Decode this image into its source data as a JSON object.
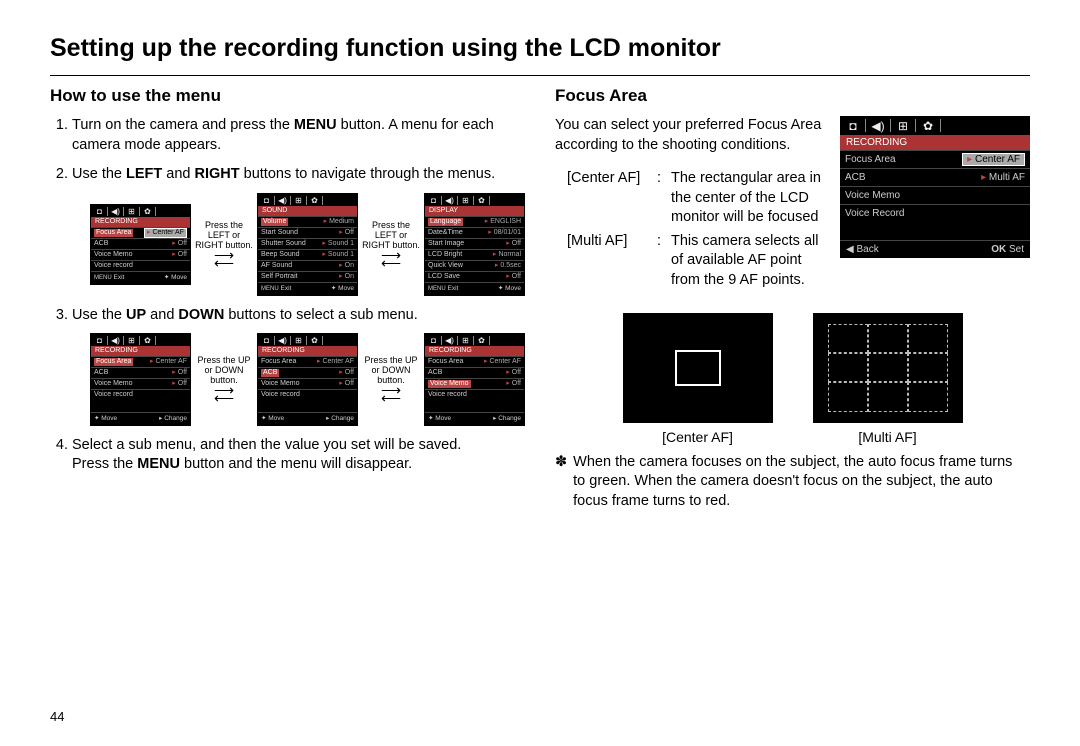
{
  "title": "Setting up the recording function using the LCD monitor",
  "page_number": "44",
  "left": {
    "heading": "How to use the menu",
    "step1_pre": "Turn on the camera and press the ",
    "step1_strong": "MENU",
    "step1_post": " button. A menu for each camera mode appears.",
    "step2_pre": "Use the ",
    "step2_s1": "LEFT",
    "step2_mid": " and ",
    "step2_s2": "RIGHT",
    "step2_post": " buttons to navigate through the menus.",
    "step3_pre": "Use the ",
    "step3_s1": "UP",
    "step3_mid": " and ",
    "step3_s2": "DOWN",
    "step3_post": " buttons to select a sub menu.",
    "step4_line1": "Select a sub menu, and then the value you set will be saved.",
    "step4_line2_pre": "Press the ",
    "step4_line2_strong": "MENU",
    "step4_line2_post": " button and the menu will disappear.",
    "press_lr": "Press the LEFT or RIGHT button.",
    "press_ud": "Press the UP or DOWN button.",
    "lcd_recording": {
      "header": "RECORDING",
      "rows": [
        {
          "l": "Focus Area",
          "r": "Center AF"
        },
        {
          "l": "ACB",
          "r": "Off"
        },
        {
          "l": "Voice Memo",
          "r": "Off"
        },
        {
          "l": "Voice record",
          "r": ""
        }
      ],
      "footer_l": "Exit",
      "footer_r": "Move"
    },
    "lcd_sound": {
      "header": "SOUND",
      "rows": [
        {
          "l": "Volume",
          "r": "Medium"
        },
        {
          "l": "Start Sound",
          "r": "Off"
        },
        {
          "l": "Shutter Sound",
          "r": "Sound 1"
        },
        {
          "l": "Beep Sound",
          "r": "Sound 1"
        },
        {
          "l": "AF Sound",
          "r": "On"
        },
        {
          "l": "Self Portrait",
          "r": "On"
        }
      ],
      "footer_l": "Exit",
      "footer_r": "Move"
    },
    "lcd_display": {
      "header": "DISPLAY",
      "rows": [
        {
          "l": "Language",
          "r": "ENGLISH"
        },
        {
          "l": "Date&Time",
          "r": "08/01/01"
        },
        {
          "l": "Start Image",
          "r": "Off"
        },
        {
          "l": "LCD Bright",
          "r": "Normal"
        },
        {
          "l": "Quick View",
          "r": "0.5sec"
        },
        {
          "l": "LCD Save",
          "r": "Off"
        }
      ],
      "footer_l": "Exit",
      "footer_r": "Move"
    },
    "lcd_rec2": {
      "header": "RECORDING",
      "rows": [
        {
          "l": "Focus Area",
          "r": "Center AF"
        },
        {
          "l": "ACB",
          "r": "Off"
        },
        {
          "l": "Voice Memo",
          "r": "Off"
        },
        {
          "l": "Voice record",
          "r": ""
        }
      ],
      "footer_l": "Move",
      "footer_r": "Change"
    }
  },
  "right": {
    "heading": "Focus Area",
    "intro": "You can select your preferred Focus Area according to the shooting conditions.",
    "center_label": "[Center AF]",
    "center_desc": "The rectangular area in the center of the LCD monitor will be focused",
    "multi_label": "[Multi AF]",
    "multi_desc": "This camera selects all of available AF point from the 9 AF points.",
    "fig_center": "[Center AF]",
    "fig_multi": "[Multi AF]",
    "note": "When the camera focuses on the subject, the auto focus frame turns to green. When the camera doesn't focus on the subject, the auto focus frame turns to red.",
    "lcd": {
      "header": "RECORDING",
      "rows": [
        {
          "l": "Focus Area",
          "r": "Center AF"
        },
        {
          "l": "ACB",
          "r": "Multi AF"
        },
        {
          "l": "Voice Memo",
          "r": ""
        },
        {
          "l": "Voice Record",
          "r": ""
        }
      ],
      "footer_l": "Back",
      "footer_r": "Set",
      "footer_l_icon": "◀",
      "footer_r_icon": "OK"
    }
  }
}
